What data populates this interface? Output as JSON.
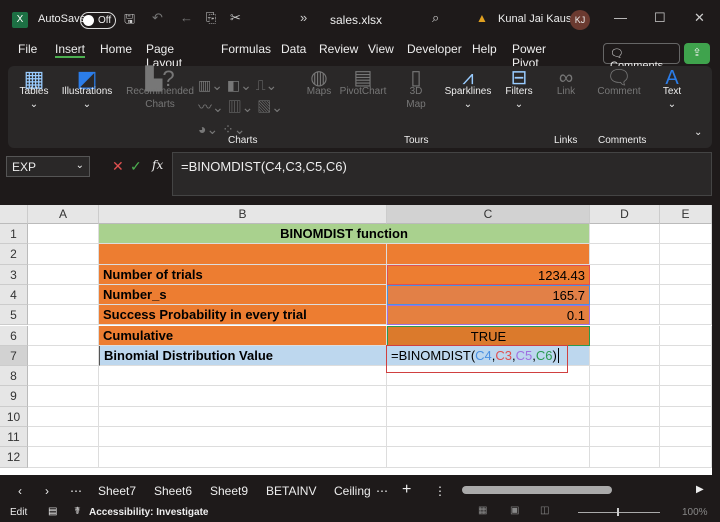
{
  "titlebar": {
    "autosave": "AutoSave",
    "toggle": "Off",
    "filename": "sales.xlsx",
    "user": "Kunal Jai Kaushik",
    "initials": "KJ"
  },
  "menu": [
    "File",
    "Insert",
    "Home",
    "Page Layout",
    "Formulas",
    "Data",
    "Review",
    "View",
    "Developer",
    "Help",
    "Power Pivot"
  ],
  "comments_button": "Comments",
  "ribbon": {
    "tables": "Tables",
    "illustrations": "Illustrations",
    "recommended": "Recommended Charts",
    "maps": "Maps",
    "pivotchart": "PivotChart",
    "map3d": "3D Map",
    "sparklines": "Sparklines",
    "filters": "Filters",
    "link": "Link",
    "comment": "Comment",
    "text": "Text",
    "charts_group": "Charts",
    "tours_group": "Tours",
    "links_group": "Links",
    "comments_group": "Comments"
  },
  "formula_bar": {
    "name_box": "EXP",
    "formula": "=BINOMDIST(C4,C3,C5,C6)",
    "fx": "fx"
  },
  "columns": [
    "A",
    "B",
    "C",
    "D",
    "E"
  ],
  "rows": [
    "1",
    "2",
    "3",
    "4",
    "5",
    "6",
    "7",
    "8",
    "9",
    "10",
    "11",
    "12"
  ],
  "cells": {
    "title": "BINOMDIST function",
    "b3": "Number of trials",
    "c3": "1234.43",
    "b4": "Number_s",
    "c4": "165.7",
    "b5": "Success Probability in every trial",
    "c5": "0.1",
    "b6": "Cumulative",
    "c6": "TRUE",
    "b7": "Binomial Distribution Value"
  },
  "edit_formula": {
    "prefix": "=BINOMDIST(",
    "a1": "C4",
    "a2": "C3",
    "a3": "C5",
    "a4": "C6",
    "sep": ",",
    "close": ")"
  },
  "ref_colors": {
    "C4": "#4a90e2",
    "C3": "#e05050",
    "C5": "#a070e0",
    "C6": "#2a9a50"
  },
  "sheets": [
    "Sheet7",
    "Sheet6",
    "Sheet9",
    "BETAINV",
    "Ceiling"
  ],
  "status": {
    "mode": "Edit",
    "accessibility": "Accessibility: Investigate",
    "zoom": "100%"
  }
}
